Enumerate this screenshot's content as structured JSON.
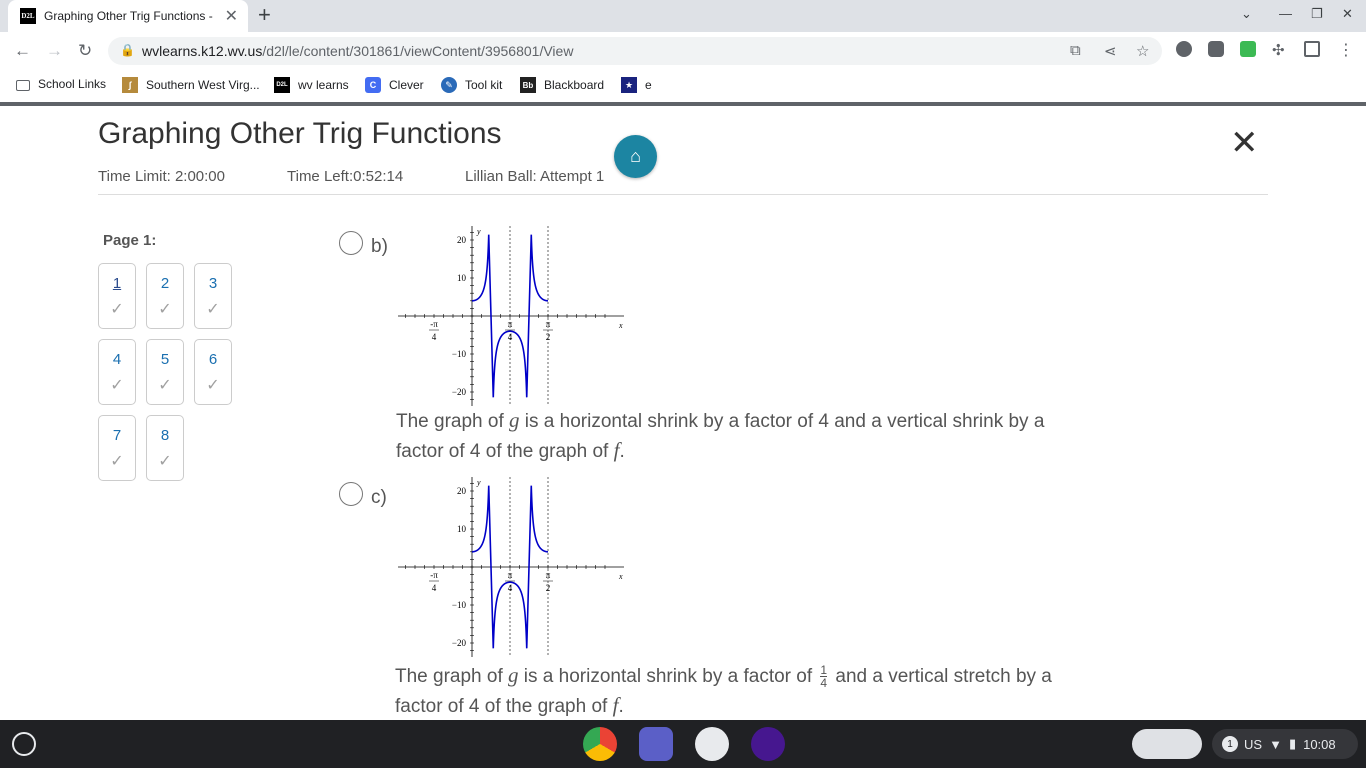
{
  "browser": {
    "tab_title": "Graphing Other Trig Functions - ",
    "tab_favicon": "D2L",
    "url_host": "wvlearns.k12.wv.us",
    "url_path": "/d2l/le/content/301861/viewContent/3956801/View",
    "bookmarks": [
      {
        "label": "School Links",
        "icon": "folder-icon"
      },
      {
        "label": "Southern West Virg...",
        "icon": "southern-wv-icon"
      },
      {
        "label": "wv learns",
        "icon": "d2l-icon"
      },
      {
        "label": "Clever",
        "icon": "clever-icon"
      },
      {
        "label": "Tool kit",
        "icon": "toolkit-icon"
      },
      {
        "label": "Blackboard",
        "icon": "blackboard-icon"
      },
      {
        "label": "e",
        "icon": "star-shield-icon"
      }
    ]
  },
  "quiz": {
    "title": "Graphing Other Trig Functions",
    "time_limit": "Time Limit: 2:00:00",
    "time_left": "Time Left:0:52:14",
    "attempt": "Lillian Ball: Attempt 1",
    "page_label": "Page 1:",
    "questions": [
      "1",
      "2",
      "3",
      "4",
      "5",
      "6",
      "7",
      "8"
    ],
    "current_question": "1"
  },
  "options": [
    {
      "letter": "b)",
      "text_pre": "The graph of ",
      "var_g": "g",
      "text_mid": " is a horizontal shrink by a factor of 4 and a vertical shrink by a factor of 4 of the graph of ",
      "var_f": "f",
      "text_end": "."
    },
    {
      "letter": "c)",
      "text_pre": "The graph of ",
      "var_g": "g",
      "text_mid": " is a horizontal shrink by a factor of ",
      "frac_num": "1",
      "frac_den": "4",
      "text_mid2": " and a vertical stretch by a factor of 4 of the graph of ",
      "var_f": "f",
      "text_end": "."
    }
  ],
  "graph_labels": {
    "y_ticks": [
      "20",
      "10",
      "−10",
      "−20"
    ],
    "x_ticks": [
      "-π/4",
      "π/4",
      "π/2"
    ],
    "x_axis": "x",
    "y_axis": "y"
  },
  "status_tray": {
    "notification_count": "1",
    "locale": "US",
    "time": "10:08"
  },
  "colors": {
    "curve": "#0000c8",
    "fab": "#1c85a2",
    "link": "#1a6fb0"
  }
}
